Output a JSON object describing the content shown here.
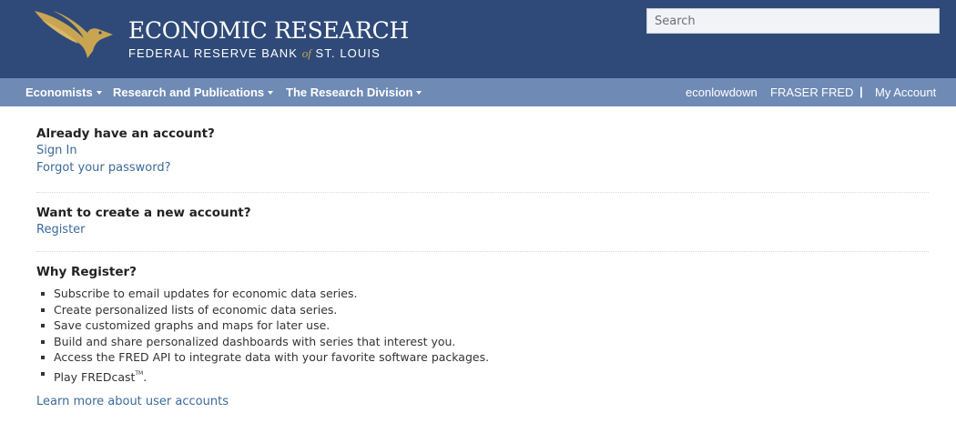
{
  "header": {
    "title": "ECONOMIC RESEARCH",
    "subtitle_left": "FEDERAL RESERVE BANK ",
    "subtitle_of": "of",
    "subtitle_right": " ST. LOUIS",
    "logo_icon": "eagle-logo-icon",
    "search_placeholder": "Search"
  },
  "nav": {
    "left": [
      {
        "label": "Economists"
      },
      {
        "label": "Research and Publications"
      },
      {
        "label": "The Research Division"
      }
    ],
    "right": [
      {
        "label": "econlowdown"
      },
      {
        "label": "FRASER"
      },
      {
        "label": "FRED"
      },
      {
        "label": "My Account"
      }
    ],
    "separator": "|"
  },
  "sections": {
    "account": {
      "heading": "Already have an account?",
      "sign_in": "Sign In",
      "forgot": "Forgot your password?"
    },
    "create": {
      "heading": "Want to create a new account?",
      "register": "Register"
    },
    "why": {
      "heading": "Why Register?",
      "items": [
        "Subscribe to email updates for economic data series.",
        "Create personalized lists of economic data series.",
        "Save customized graphs and maps for later use.",
        "Build and share personalized dashboards with series that interest you.",
        "Access the FRED API to integrate data with your favorite software packages."
      ],
      "last_item_prefix": "Play FREDcast",
      "trademark": "TM",
      "last_item_suffix": "."
    },
    "learn_more": "Learn more about user accounts"
  },
  "colors": {
    "header_bg": "#2f4a78",
    "nav_bg": "#6f8ab5",
    "logo_gold": "#c9a552",
    "link": "#3c6a9a"
  }
}
